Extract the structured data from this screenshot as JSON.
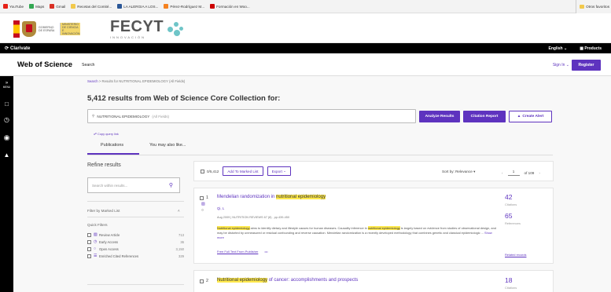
{
  "bookmarks": [
    {
      "label": "YouTube",
      "color": "#e62117"
    },
    {
      "label": "Maps",
      "color": "#34a853"
    },
    {
      "label": "Gmail",
      "color": "#d93025"
    },
    {
      "label": "Recetas del Comité...",
      "color": "#f2c94c"
    },
    {
      "label": "LA ALERGIA A LOS...",
      "color": "#2b5797"
    },
    {
      "label": "Pérez-Rodríguez M...",
      "color": "#f58220"
    },
    {
      "label": "Formación en Woo...",
      "color": "#c00"
    }
  ],
  "bookmarks_other": "Otros favoritos",
  "header": {
    "ministry_line": "GOBIERNO DE ESPAÑA",
    "ministry_line2": "MINISTERIO DE CIENCIA E INNOVACIÓN",
    "fecyt": "FECYT",
    "fecyt_sub": "INNOVACIÓN"
  },
  "clarivate": {
    "logo": "Clarivate",
    "language": "English",
    "products": "Products"
  },
  "wos": {
    "brand": "Web of Science",
    "search": "Search",
    "signin": "Sign In",
    "register": "Register"
  },
  "sidebar": {
    "menu": "MENU"
  },
  "breadcrumb": {
    "search": "Search",
    "current": "Results for NUTRITIONAL EPIDEMIOLOGY (All Fields)"
  },
  "results": {
    "heading": "5,412 results from Web of Science Core Collection for:"
  },
  "query": {
    "text": "NUTRITIONAL EPIDEMIOLOGY",
    "field": "(All Fields)"
  },
  "buttons": {
    "analyze": "Analyze Results",
    "citation_report": "Citation Report",
    "create_alert": "Create Alert"
  },
  "copy_query": "Copy query link",
  "tabs": [
    "Publications",
    "You may also like..."
  ],
  "refine": {
    "title": "Refine results",
    "search_placeholder": "Search within results...",
    "filter_marked": "Filter by Marked List",
    "quick_filters": "Quick Filters",
    "items": [
      {
        "label": "Review Article",
        "count": "713"
      },
      {
        "label": "Early Access",
        "count": "36"
      },
      {
        "label": "Open Access",
        "count": "3,150"
      },
      {
        "label": "Enriched Cited References",
        "count": "329"
      }
    ]
  },
  "toolbar": {
    "count": "0/5,412",
    "add_marked": "Add To Marked List",
    "export": "Export",
    "sort": "Sort by: Relevance",
    "page": "1",
    "of_pages": "of 109"
  },
  "records": [
    {
      "num": "1",
      "title_pre": "Mendelian randomization in ",
      "title_hl": "nutritional epidemiology",
      "title_post": "",
      "author": "Qi, L",
      "meta": "Aug 2009 | NUTRITION REVIEWS 67 (8) , pp.439-450",
      "abstract_hl": "Nutritional epidemiology",
      "abstract_a": " aims to identify dietary and lifestyle causes for human diseases. Causality inference in ",
      "abstract_hl2": "nutritional epidemiology",
      "abstract_b": " is largely based on evidence from studies of observational design, and may be distorted by unmeasured or residual confounding and reverse causation. Mendelian randomization is a recently developed methodology that combines genetic and classical epidemiologic ...",
      "show_more": "Show more",
      "full_text": "Free Full Text From Publisher",
      "citations": "42",
      "citations_label": "Citations",
      "references": "65",
      "references_label": "References",
      "related": "Related records"
    },
    {
      "num": "2",
      "title_hl": "Nutritional epidemiology",
      "title_post": " of cancer: accomplishments and prospects",
      "citations": "18",
      "citations_label": "Citations"
    }
  ]
}
